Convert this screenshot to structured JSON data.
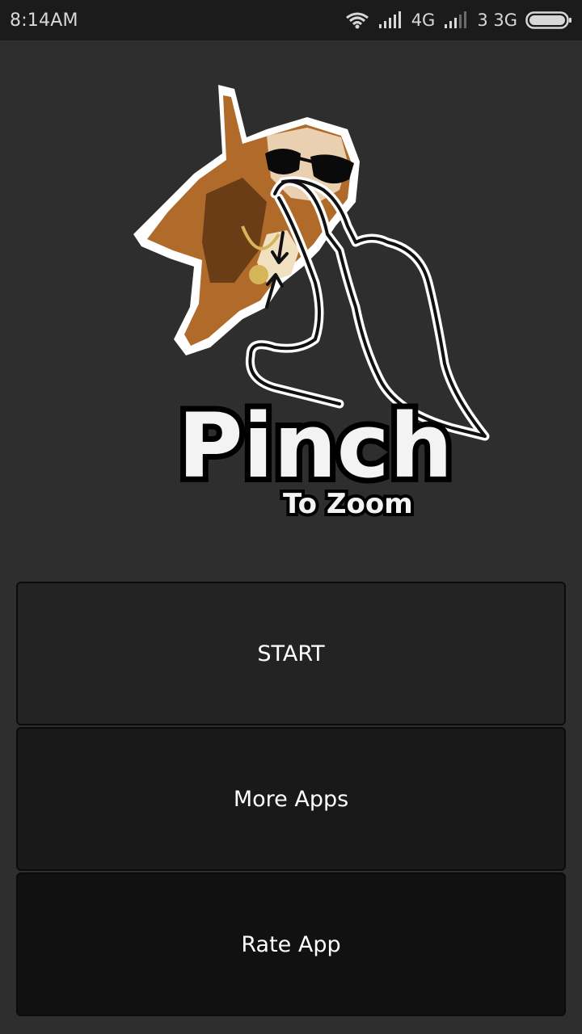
{
  "status_bar": {
    "time": "8:14AM",
    "network_1": "4G",
    "network_2": "3 3G"
  },
  "logo": {
    "title": "Pinch",
    "subtitle": "To Zoom"
  },
  "buttons": {
    "start": "START",
    "more_apps": "More Apps",
    "rate_app": "Rate App"
  },
  "colors": {
    "background": "#2e2e2e",
    "status_bar": "#1b1b1b",
    "button_text": "#ffffff"
  }
}
